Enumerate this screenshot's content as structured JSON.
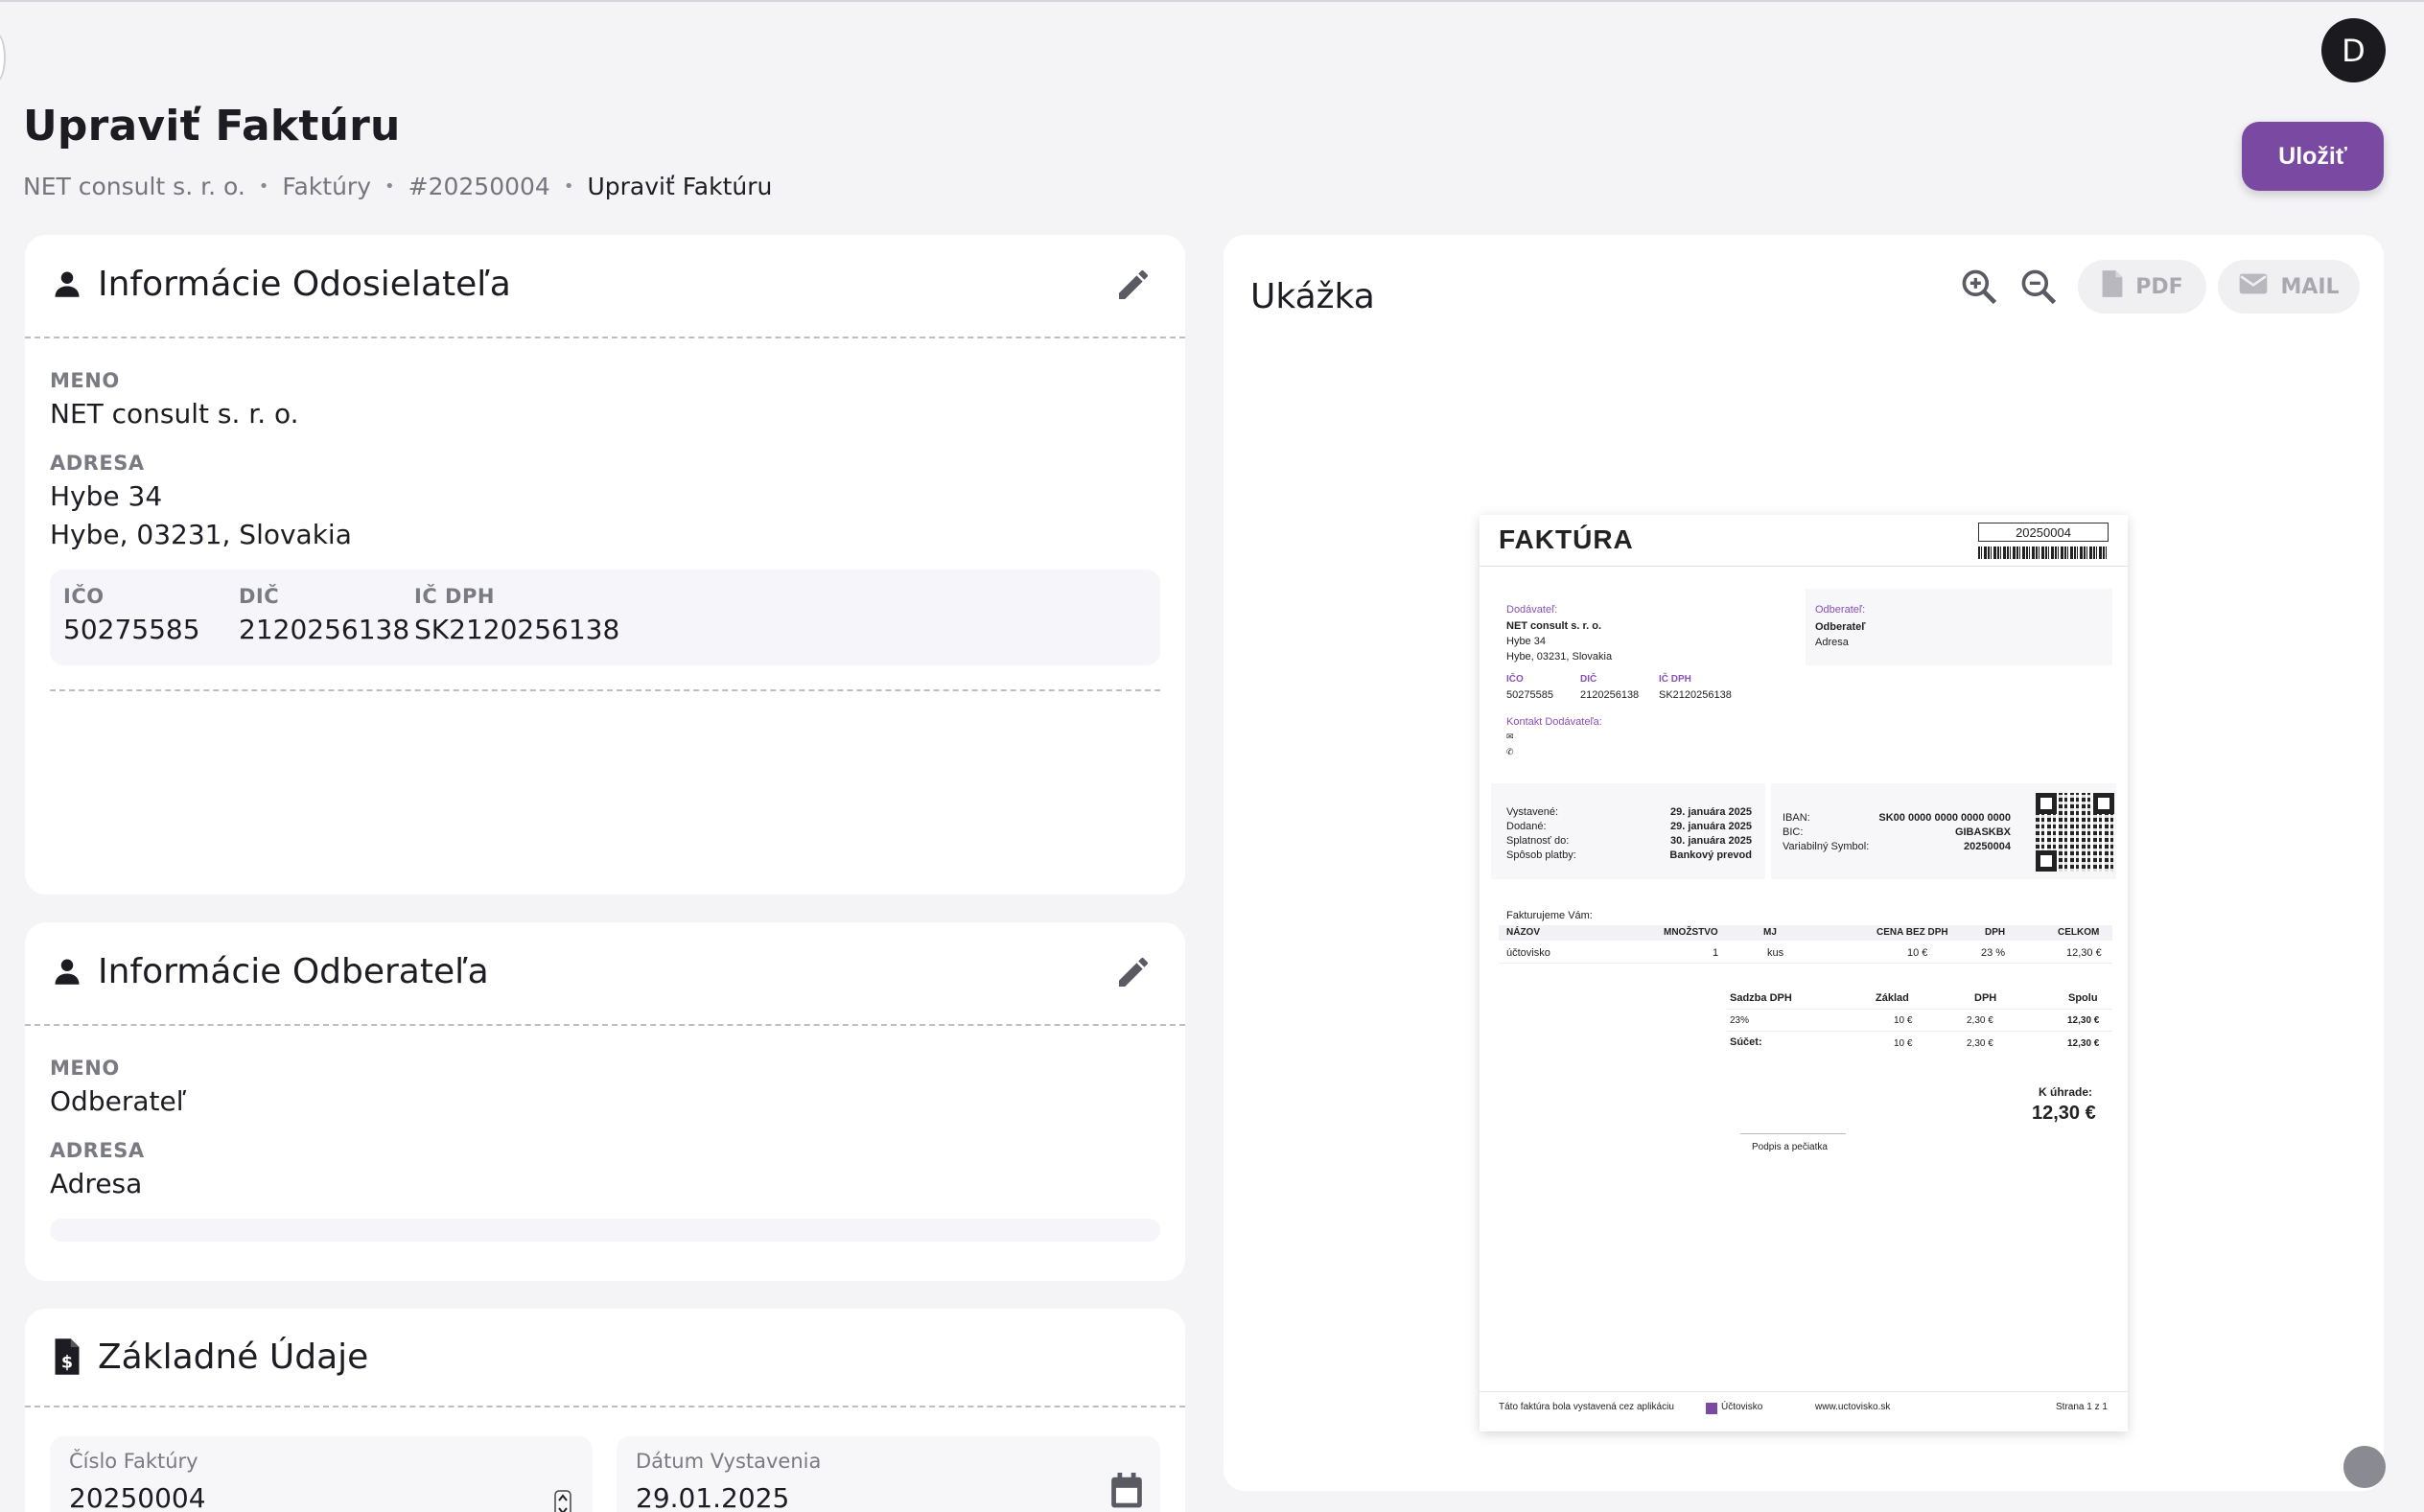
{
  "user": {
    "avatar_initial": "D"
  },
  "page": {
    "title": "Upraviť Faktúru",
    "breadcrumb": [
      "NET consult s. r. o.",
      "Faktúry",
      "#20250004",
      "Upraviť Faktúru"
    ],
    "save_label": "Uložiť"
  },
  "sender": {
    "title": "Informácie Odosielateľa",
    "name_label": "MENO",
    "name": "NET consult s. r. o.",
    "address_label": "ADRESA",
    "address_line1": "Hybe 34",
    "address_line2": "Hybe, 03231, Slovakia",
    "ico_label": "IČO",
    "ico": "50275585",
    "dic_label": "DIČ",
    "dic": "2120256138",
    "icdph_label": "IČ DPH",
    "icdph": "SK2120256138"
  },
  "recipient": {
    "title": "Informácie Odberateľa",
    "name_label": "MENO",
    "name": "Odberateľ",
    "address_label": "ADRESA",
    "address": "Adresa"
  },
  "basic": {
    "title": "Základné Údaje",
    "invoice_no_label": "Číslo Faktúry",
    "invoice_no": "20250004",
    "issue_date_label": "Dátum Vystavenia",
    "issue_date": "29.01.2025"
  },
  "preview": {
    "title": "Ukážka",
    "pdf_label": "PDF",
    "mail_label": "MAIL"
  },
  "invoice": {
    "heading": "FAKTÚRA",
    "number": "20250004",
    "supplier_label": "Dodávateľ:",
    "supplier_name": "NET consult s. r. o.",
    "supplier_addr1": "Hybe 34",
    "supplier_addr2": "Hybe, 03231, Slovakia",
    "ico_label": "IČO",
    "ico": "50275585",
    "dic_label": "DIČ",
    "dic": "2120256138",
    "icdph_label": "IČ DPH",
    "icdph": "SK2120256138",
    "contact_label": "Kontakt Dodávateľa:",
    "customer_label": "Odberateľ:",
    "customer_name": "Odberateľ",
    "customer_addr": "Adresa",
    "issued_label": "Vystavené:",
    "issued": "29. januára 2025",
    "delivered_label": "Dodané:",
    "delivered": "29. januára 2025",
    "due_label": "Splatnosť do:",
    "due": "30. januára 2025",
    "payment_label": "Spôsob platby:",
    "payment": "Bankový prevod",
    "iban_label": "IBAN:",
    "iban": "SK00 0000 0000 0000 0000",
    "bic_label": "BIC:",
    "bic": "GIBASKBX",
    "vs_label": "Variabilný Symbol:",
    "vs": "20250004",
    "intro": "Fakturujeme Vám:",
    "cols": [
      "NÁZOV",
      "MNOŽSTVO",
      "MJ",
      "CENA BEZ DPH",
      "DPH",
      "CELKOM"
    ],
    "item": [
      "účtovisko",
      "1",
      "kus",
      "10 €",
      "23 %",
      "12,30 €"
    ],
    "vat_cols": [
      "Sadzba DPH",
      "Základ",
      "DPH",
      "Spolu"
    ],
    "vat_row": [
      "23%",
      "10 €",
      "2,30 €",
      "12,30 €"
    ],
    "sum_row": [
      "Súčet:",
      "10 €",
      "2,30 €",
      "12,30 €"
    ],
    "to_pay_label": "K úhrade:",
    "to_pay": "12,30 €",
    "signature": "Podpis a pečiatka",
    "footer_text": "Táto faktúra bola vystavená cez aplikáciu",
    "footer_app": "Účtovisko",
    "footer_web": "www.uctovisko.sk",
    "footer_page": "Strana 1 z 1"
  }
}
